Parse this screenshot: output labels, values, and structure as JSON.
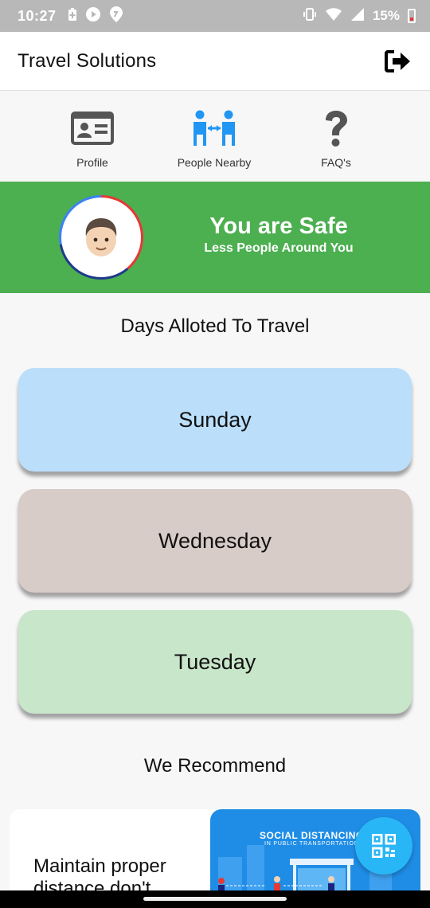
{
  "status_bar": {
    "time": "10:27",
    "battery": "15%"
  },
  "app_bar": {
    "title": "Travel Solutions"
  },
  "quick_menu": [
    {
      "label": "Profile",
      "icon": "profile-card-icon"
    },
    {
      "label": "People Nearby",
      "icon": "people-nearby-icon"
    },
    {
      "label": "FAQ's",
      "icon": "question-icon"
    }
  ],
  "safety_banner": {
    "title": "You are Safe",
    "subtitle": "Less People Around You",
    "color": "#4caf50"
  },
  "days_section": {
    "title": "Days Alloted To Travel",
    "days": [
      {
        "label": "Sunday",
        "color": "#bbdefb"
      },
      {
        "label": "Wednesday",
        "color": "#d7ccc8"
      },
      {
        "label": "Tuesday",
        "color": "#c8e6c9"
      }
    ]
  },
  "recommend_section": {
    "title": "We Recommend",
    "card_text": "Maintain proper distance don't",
    "image_title": "SOCIAL DISTANCING",
    "image_subtitle": "IN PUBLIC TRANSPORTATION"
  },
  "fab": {
    "icon": "qr-code-icon",
    "color": "#29b6f6"
  }
}
